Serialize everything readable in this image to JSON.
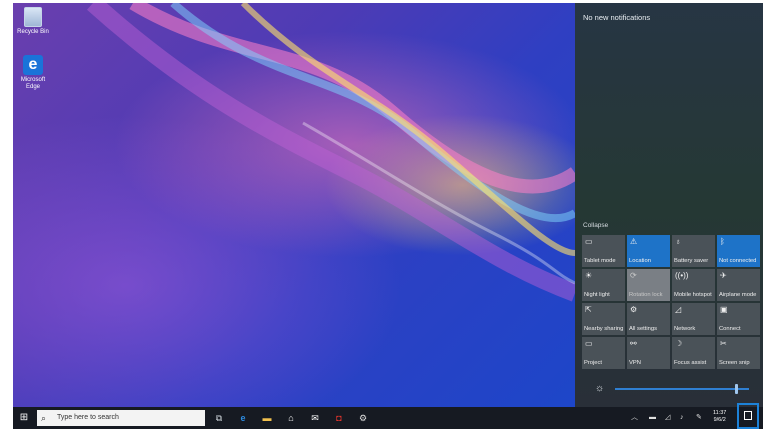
{
  "desktop": {
    "icons": [
      {
        "label": "Recycle Bin",
        "icon": "recycle-bin-icon"
      },
      {
        "label": "Microsoft Edge",
        "icon": "edge-icon"
      }
    ]
  },
  "action_center": {
    "notifications_text": "No new notifications",
    "collapse_label": "Collapse",
    "tiles": [
      {
        "label": "Tablet mode",
        "icon": "tablet-mode-icon",
        "state": "off"
      },
      {
        "label": "Location",
        "icon": "location-icon",
        "state": "on"
      },
      {
        "label": "Battery saver",
        "icon": "battery-saver-icon",
        "state": "off"
      },
      {
        "label": "Not connected",
        "icon": "bluetooth-icon",
        "state": "on"
      },
      {
        "label": "Night light",
        "icon": "night-light-icon",
        "state": "off"
      },
      {
        "label": "Rotation lock",
        "icon": "rotation-lock-icon",
        "state": "disabled"
      },
      {
        "label": "Mobile hotspot",
        "icon": "mobile-hotspot-icon",
        "state": "off"
      },
      {
        "label": "Airplane mode",
        "icon": "airplane-mode-icon",
        "state": "off"
      },
      {
        "label": "Nearby sharing",
        "icon": "nearby-sharing-icon",
        "state": "off"
      },
      {
        "label": "All settings",
        "icon": "settings-icon",
        "state": "off"
      },
      {
        "label": "Network",
        "icon": "network-icon",
        "state": "off"
      },
      {
        "label": "Connect",
        "icon": "connect-icon",
        "state": "off"
      },
      {
        "label": "Project",
        "icon": "project-icon",
        "state": "off"
      },
      {
        "label": "VPN",
        "icon": "vpn-icon",
        "state": "off"
      },
      {
        "label": "Focus assist",
        "icon": "focus-assist-icon",
        "state": "off"
      },
      {
        "label": "Screen snip",
        "icon": "screen-snip-icon",
        "state": "off"
      }
    ],
    "brightness_level": 0.9
  },
  "taskbar": {
    "search_placeholder": "Type here to search",
    "clock_time": "11:37",
    "clock_date": "9/6/2"
  },
  "colors": {
    "accent": "#1e73c8",
    "taskbar_bg": "#161a22",
    "highlight_border": "#1d82d8"
  }
}
